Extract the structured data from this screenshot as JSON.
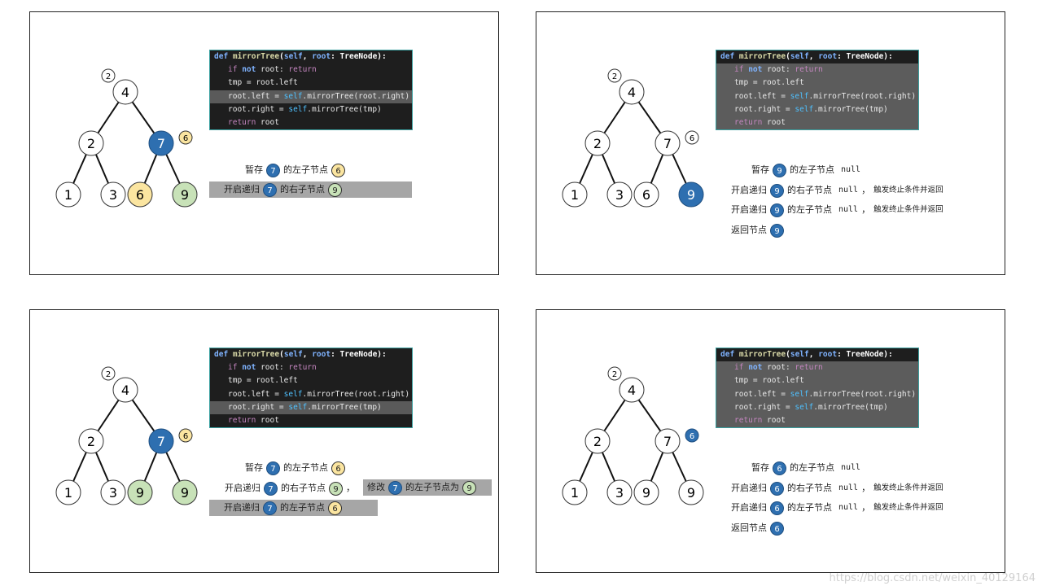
{
  "code": {
    "line0": {
      "def": "def",
      "fn": "mirrorTree",
      "open": "(",
      "self": "self",
      "comma": ", ",
      "root": "root",
      "colon": ": ",
      "type": "TreeNode",
      "close": "):"
    },
    "line1": {
      "if": "if",
      "not": "not",
      "mid": " root: ",
      "ret": "return"
    },
    "line2": "tmp = root.left",
    "line3": {
      "a": "root.left = ",
      "self": "self",
      "b": ".mirrorTree(root.right)"
    },
    "line4": {
      "a": "root.right = ",
      "self": "self",
      "b": ".mirrorTree(tmp)"
    },
    "line5": {
      "ret": "return",
      "b": " root"
    }
  },
  "labels": {
    "save": "暂存",
    "recurse": "开启递归",
    "left_child": "的左子节点",
    "right_child": "的右子节点",
    "null": "null",
    "comma": "，",
    "terminate": "触发终止条件并返回",
    "return_node": "返回节点",
    "modify": "修改",
    "left_child_to": "的左子节点为"
  },
  "nodes": {
    "n4": "4",
    "n2": "2",
    "n7": "7",
    "n1": "1",
    "n3": "3",
    "n6": "6",
    "n9": "9",
    "tag2": "2",
    "tag6": "6"
  },
  "panels": [
    {
      "leaf3": "6",
      "leaf4": "9"
    },
    {
      "leaf3": "6",
      "leaf4": "9"
    },
    {
      "leaf3": "9",
      "leaf4": "9"
    },
    {
      "leaf3": "9",
      "leaf4": "9"
    }
  ],
  "colors": {
    "blue": "#2e6fb0",
    "yellow": "#fbe5a0",
    "green": "#c8e2b8",
    "highlight": "#a6a6a6"
  },
  "watermark": "https://blog.csdn.net/weixin_40129164"
}
